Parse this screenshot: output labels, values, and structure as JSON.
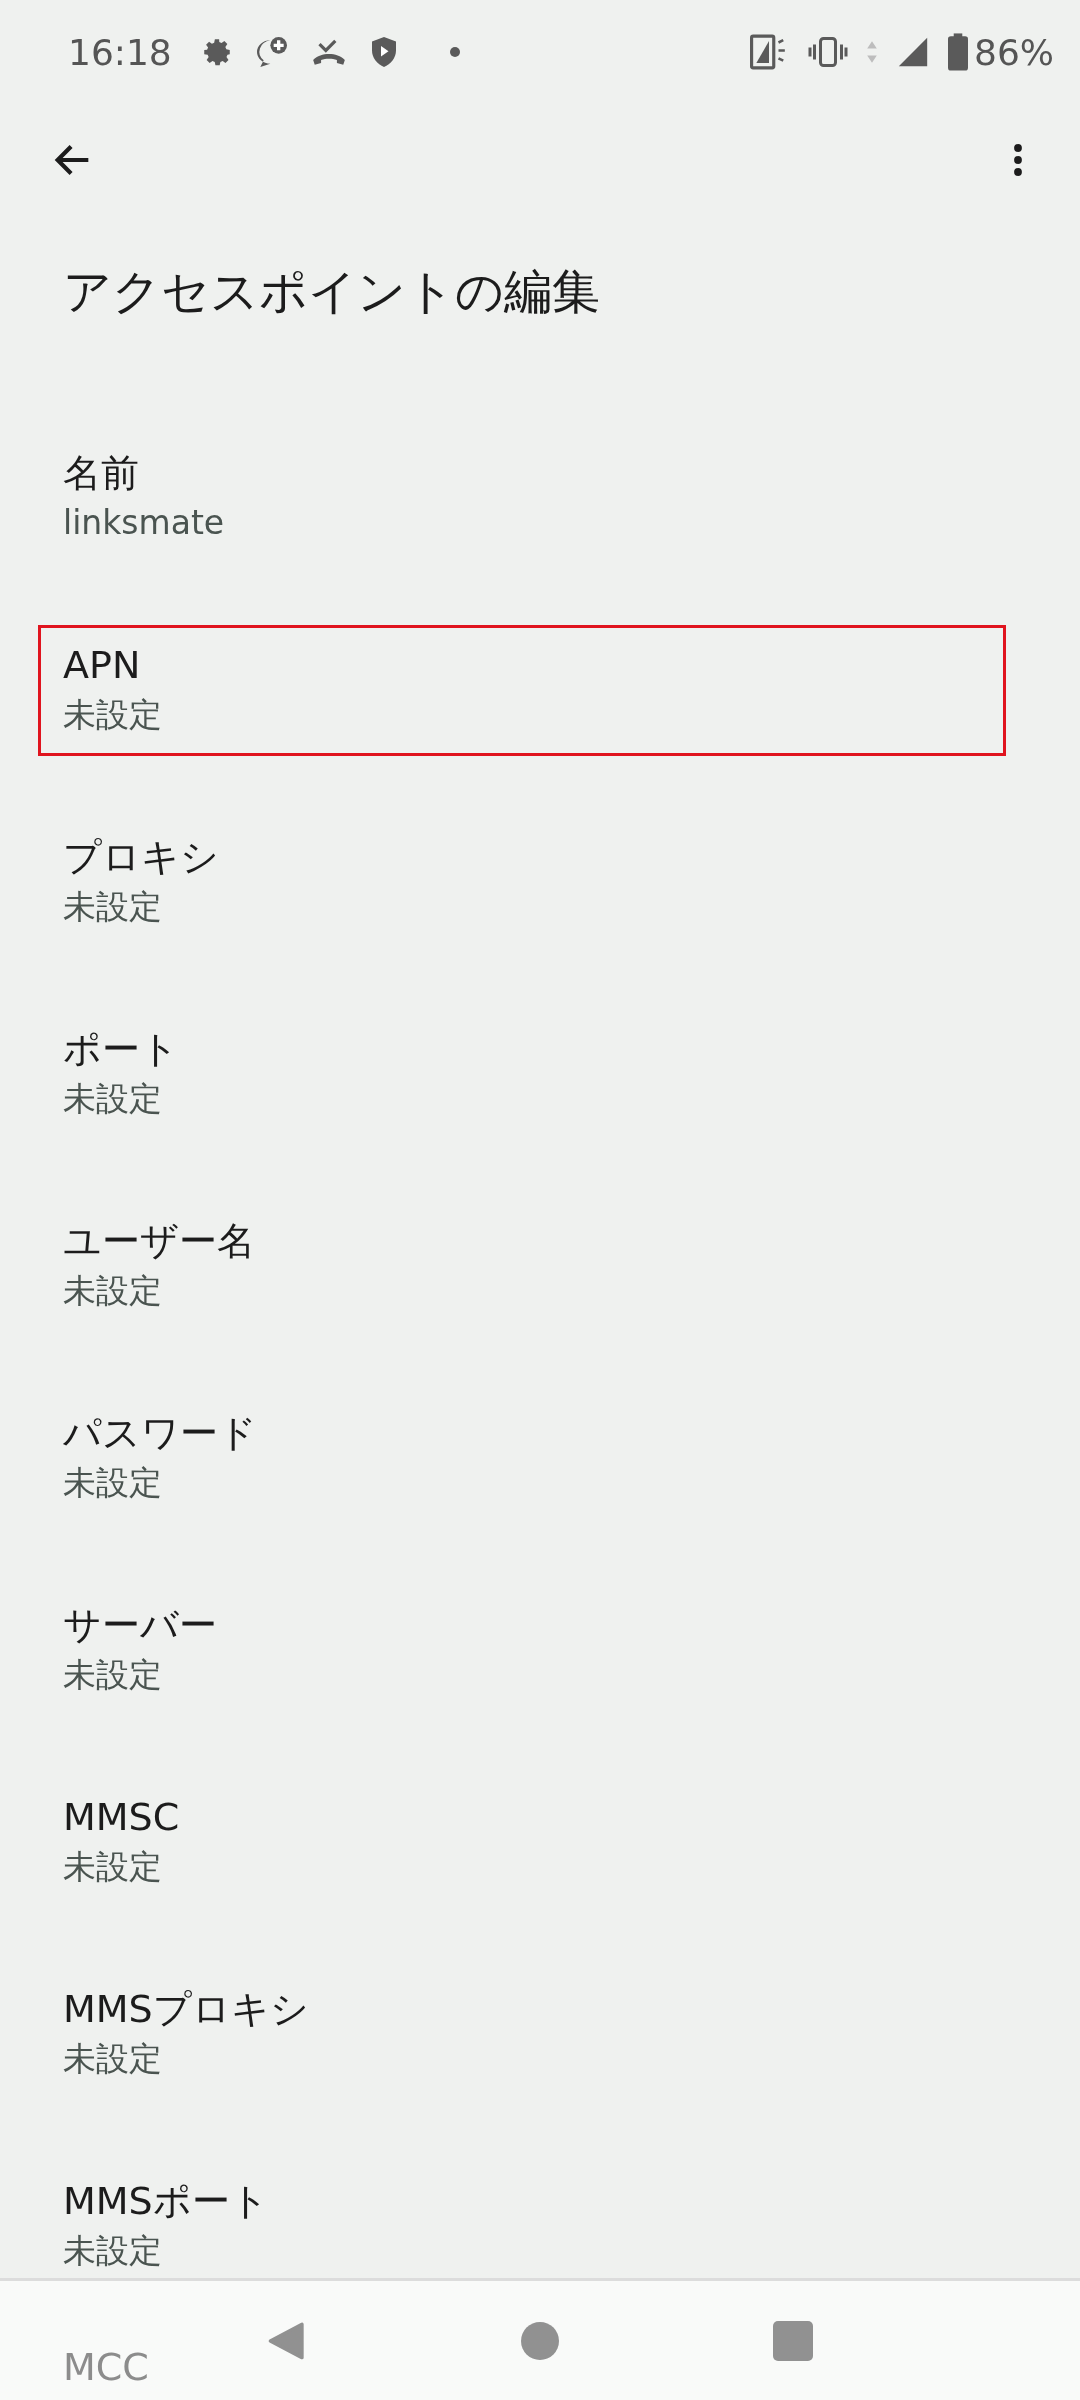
{
  "status_bar": {
    "time": "16:18",
    "battery": "86%"
  },
  "title": "アクセスポイントの編集",
  "items": [
    {
      "title": "名前",
      "summary": "linksmate",
      "highlighted": false
    },
    {
      "title": "APN",
      "summary": "未設定",
      "highlighted": true
    },
    {
      "title": "プロキシ",
      "summary": "未設定",
      "highlighted": false
    },
    {
      "title": "ポート",
      "summary": "未設定",
      "highlighted": false
    },
    {
      "title": "ユーザー名",
      "summary": "未設定",
      "highlighted": false
    },
    {
      "title": "パスワード",
      "summary": "未設定",
      "highlighted": false
    },
    {
      "title": "サーバー",
      "summary": "未設定",
      "highlighted": false
    },
    {
      "title": "MMSC",
      "summary": "未設定",
      "highlighted": false
    },
    {
      "title": "MMSプロキシ",
      "summary": "未設定",
      "highlighted": false
    },
    {
      "title": "MMSポート",
      "summary": "未設定",
      "highlighted": false
    },
    {
      "title": "MCC",
      "highlighted": false
    }
  ]
}
